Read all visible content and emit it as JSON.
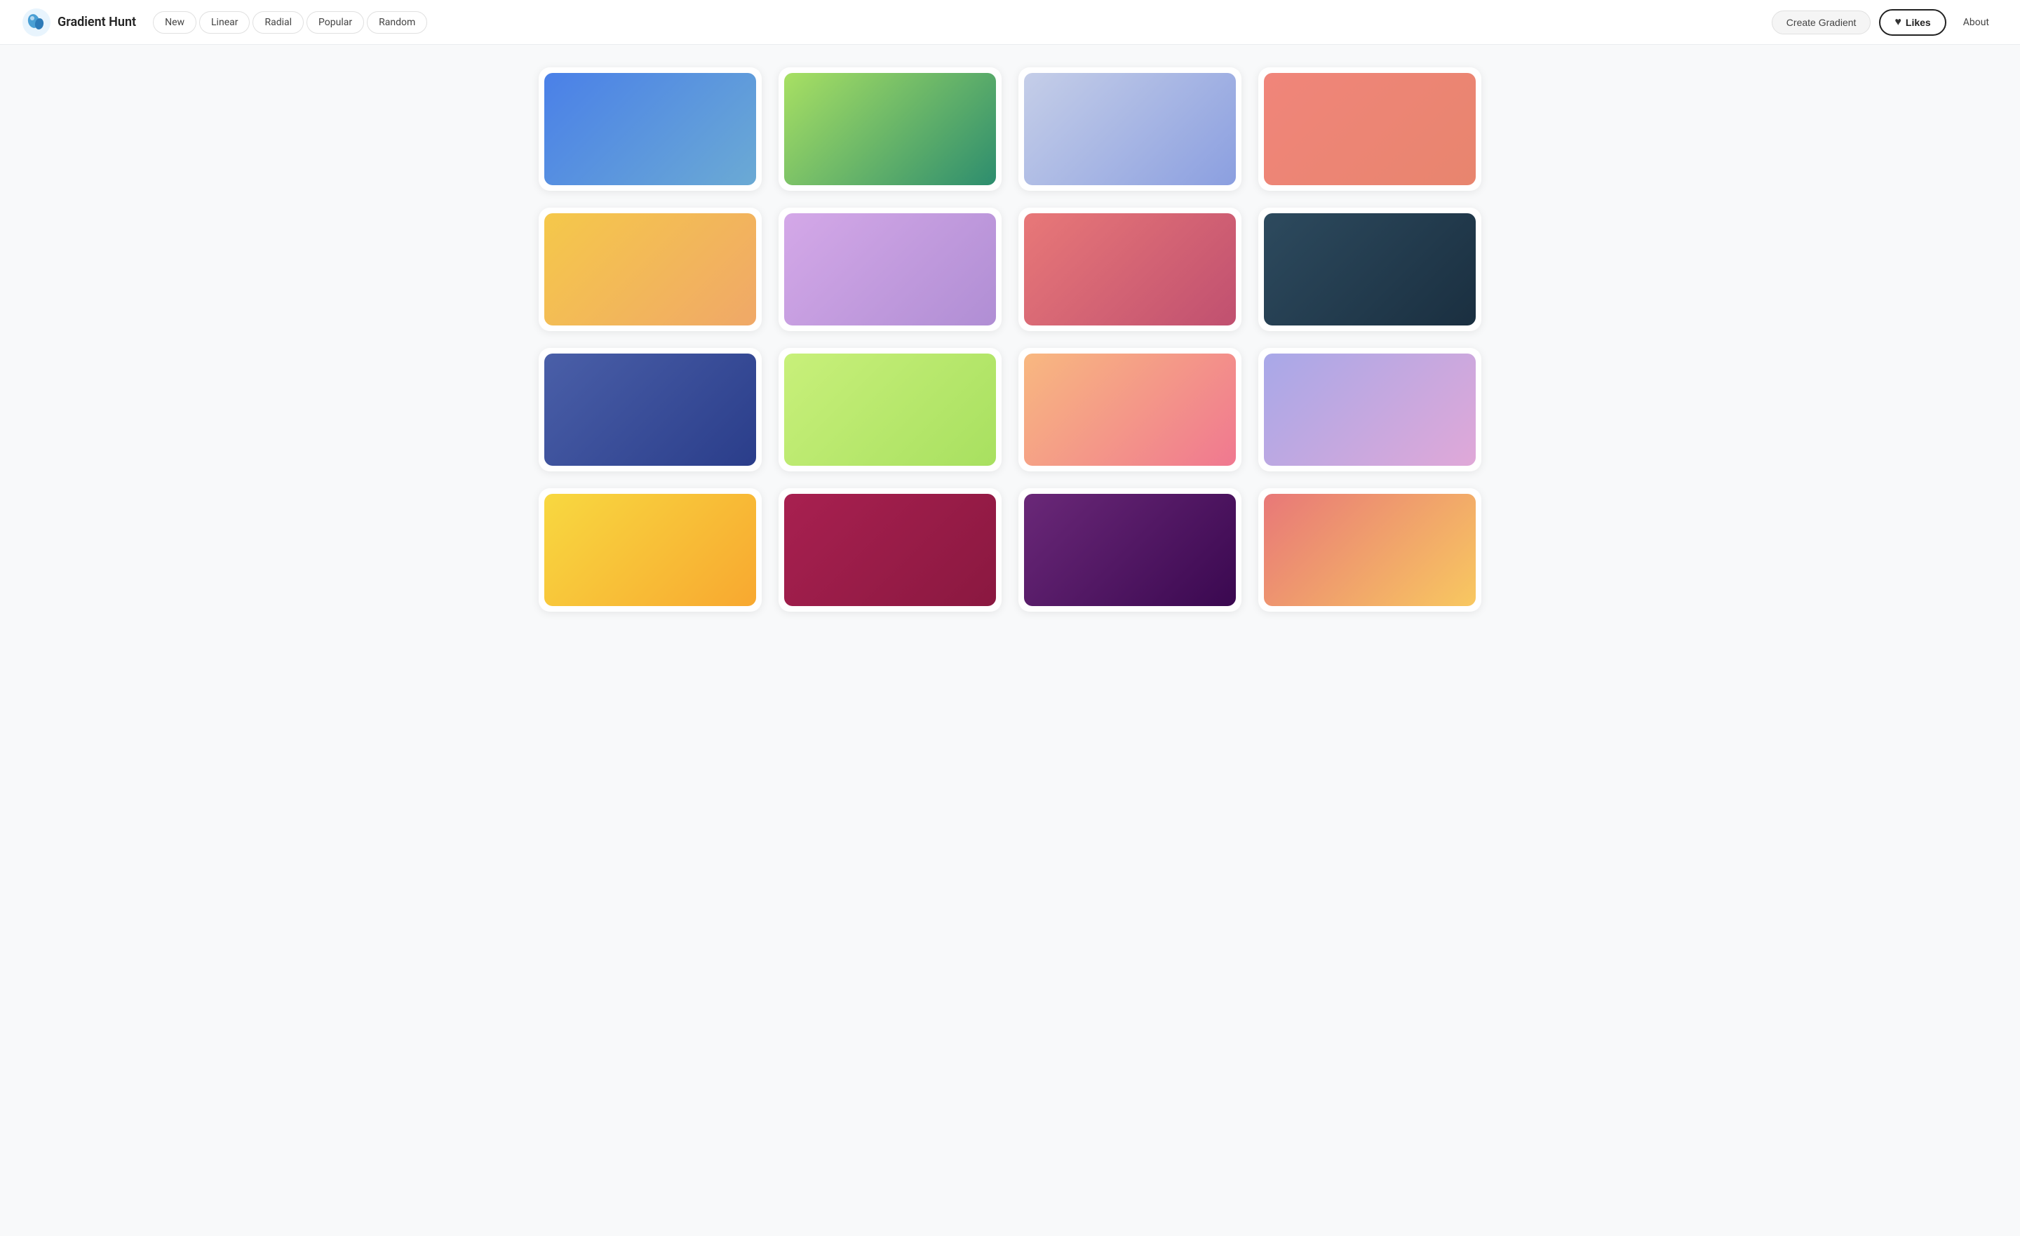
{
  "header": {
    "logo_text": "Gradient Hunt",
    "nav_items": [
      {
        "id": "new",
        "label": "New"
      },
      {
        "id": "linear",
        "label": "Linear"
      },
      {
        "id": "radial",
        "label": "Radial"
      },
      {
        "id": "popular",
        "label": "Popular"
      },
      {
        "id": "random",
        "label": "Random"
      }
    ],
    "create_btn_label": "Create Gradient",
    "likes_btn_label": "Likes",
    "about_label": "About"
  },
  "gradients": [
    {
      "id": 1,
      "gradient": "linear-gradient(135deg, #4a80e8 0%, #6baad4 100%)"
    },
    {
      "id": 2,
      "gradient": "linear-gradient(135deg, #a8e063 0%, #2d8d6e 100%)"
    },
    {
      "id": 3,
      "gradient": "linear-gradient(135deg, #c5cee8 0%, #8b9fe0 100%)"
    },
    {
      "id": 4,
      "gradient": "linear-gradient(135deg, #f0857a 0%, #e8856e 100%)"
    },
    {
      "id": 5,
      "gradient": "linear-gradient(135deg, #f5c84a 0%, #f0a868 100%)"
    },
    {
      "id": 6,
      "gradient": "linear-gradient(135deg, #d4a8e8 0%, #b08ed4 100%)"
    },
    {
      "id": 7,
      "gradient": "linear-gradient(135deg, #e87878 0%, #c05070 100%)"
    },
    {
      "id": 8,
      "gradient": "linear-gradient(135deg, #2d4a5e 0%, #1a2f40 100%)"
    },
    {
      "id": 9,
      "gradient": "linear-gradient(135deg, #4a5fa8 0%, #2a3d8a 100%)"
    },
    {
      "id": 10,
      "gradient": "linear-gradient(135deg, #c8f07a 0%, #a8e060 100%)"
    },
    {
      "id": 11,
      "gradient": "linear-gradient(135deg, #f8b880 0%, #f07890 100%)"
    },
    {
      "id": 12,
      "gradient": "linear-gradient(135deg, #a8a8e8 0%, #e0a8d8 100%)"
    },
    {
      "id": 13,
      "gradient": "linear-gradient(135deg, #f8d840 0%, #f8a830 100%)"
    },
    {
      "id": 14,
      "gradient": "linear-gradient(135deg, #a82050 0%, #8a1840 100%)"
    },
    {
      "id": 15,
      "gradient": "linear-gradient(135deg, #6a2878 0%, #3a0850 100%)"
    },
    {
      "id": 16,
      "gradient": "linear-gradient(135deg, #e87878 0%, #f8c860 100%)"
    }
  ]
}
